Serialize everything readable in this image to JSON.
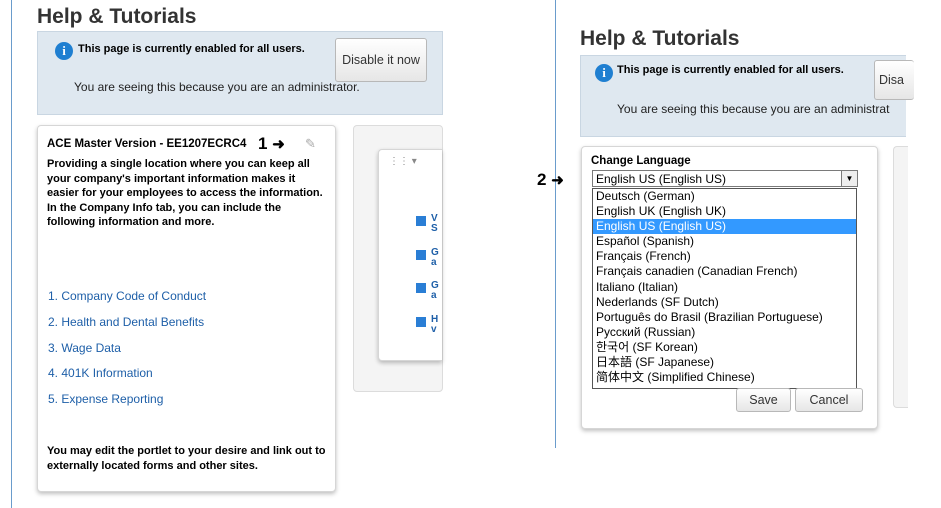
{
  "left": {
    "title": "Help & Tutorials",
    "banner": {
      "message": "This page is currently enabled for all users.",
      "sub": "You are seeing this because you are an administrator.",
      "disable_button": "Disable it now"
    },
    "card": {
      "header": "ACE Master Version - EE1207ECRC4",
      "callout_number": "1",
      "intro": "Providing a single location where you can keep all your company's important information makes it easier for your employees to access the information.  In the Company Info tab, you can include the following information and more.",
      "links": [
        "1.  Company Code of Conduct",
        "2.  Health and Dental Benefits",
        "3.  Wage Data",
        "4.  401K Information",
        "5.  Expense Reporting"
      ],
      "footer": "You may edit the portlet to your desire and link out to externally located forms and other sites."
    },
    "side_stubs": [
      "V\nS",
      "G\na",
      "G\na",
      "H\nv"
    ]
  },
  "right": {
    "title": "Help & Tutorials",
    "banner": {
      "message": "This page is currently enabled for all users.",
      "sub": "You are seeing this because you are an administrat",
      "disable_button": "Disa"
    },
    "callout_number": "2",
    "change_language": {
      "label": "Change Language",
      "selected": "English US (English US)",
      "options": [
        "Deutsch (German)",
        "English UK (English UK)",
        "English US (English US)",
        "Español (Spanish)",
        "Français (French)",
        "Français canadien (Canadian French)",
        "Italiano (Italian)",
        "Nederlands (SF Dutch)",
        "Português do Brasil (Brazilian Portuguese)",
        "Русский (Russian)",
        "한국어  (SF Korean)",
        "日本語  (SF Japanese)",
        "简体中文  (Simplified Chinese)"
      ],
      "highlighted_index": 2,
      "save_button": "Save",
      "cancel_button": "Cancel"
    }
  },
  "colors": {
    "link": "#1e5fa8",
    "highlight": "#3399ff",
    "info": "#1f7fd1"
  }
}
